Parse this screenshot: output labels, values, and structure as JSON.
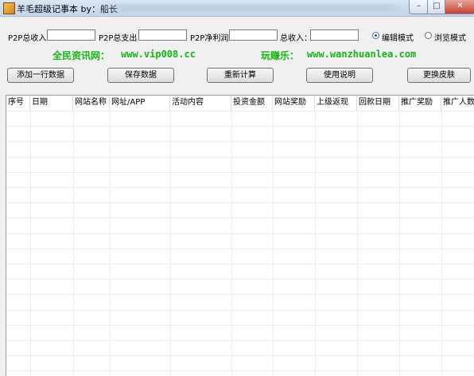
{
  "window": {
    "title": "羊毛超级记事本 by：船长",
    "min_glyph": "–",
    "max_glyph": "□",
    "close_glyph": "✕"
  },
  "summary": {
    "income_label": "P2P总收入：",
    "income_value": "",
    "expense_label": "P2P总支出：",
    "expense_value": "",
    "profit_label": "P2P净利润：",
    "profit_value": "",
    "total_label": "总收入：",
    "total_value": ""
  },
  "mode": {
    "edit_label": "编辑模式",
    "browse_label": "浏览模式",
    "selected": "edit"
  },
  "promo": {
    "left_name": "全民资讯网：",
    "left_url": "www.vip008.cc",
    "right_name": "玩赚乐：",
    "right_url": "www.wanzhuanlea.com"
  },
  "toolbar": {
    "add_row": "添加一行数据",
    "save": "保存数据",
    "recalc": "重新计算",
    "help": "使用说明",
    "skin": "更换皮肤"
  },
  "table": {
    "columns": [
      "序号",
      "日期",
      "网站名称",
      "网址/APP",
      "活动内容",
      "投资金额",
      "网站奖励",
      "上级返现",
      "回款日期",
      "推广奖励",
      "推广人数"
    ],
    "rows": []
  }
}
